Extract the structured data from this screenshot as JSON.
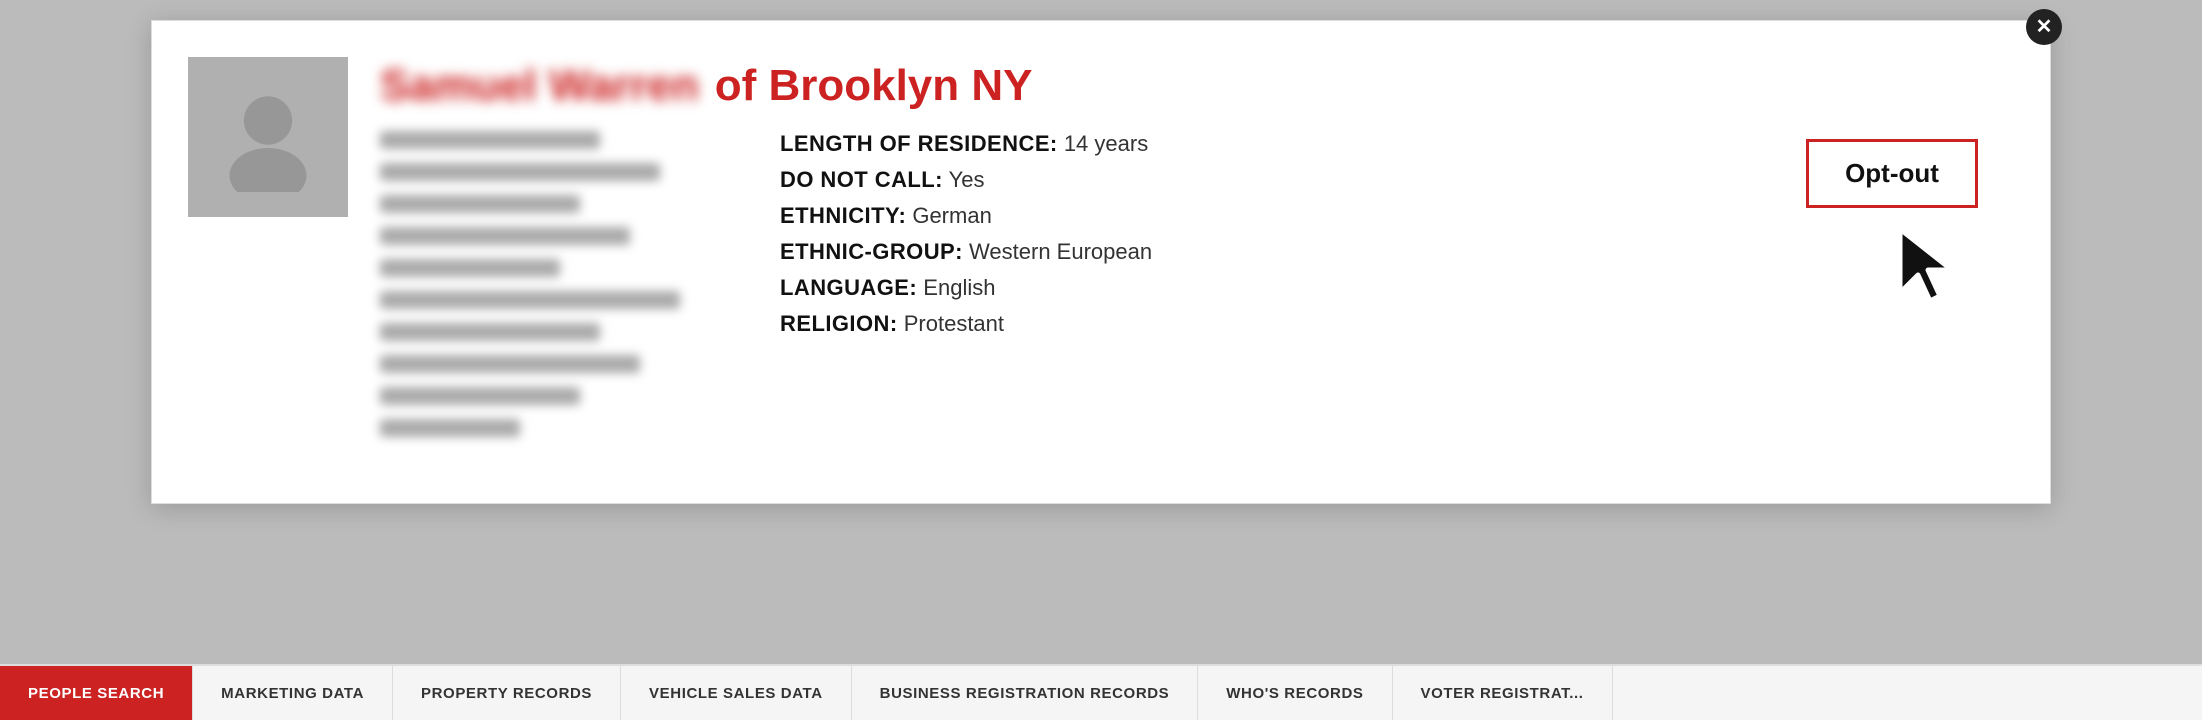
{
  "modal": {
    "close_label": "✕",
    "name_blurred": "Samuel Warren",
    "location": "of Brooklyn NY",
    "opt_out_label": "Opt-out",
    "details_right": [
      {
        "label": "LENGTH OF RESIDENCE:",
        "value": "14 years"
      },
      {
        "label": "DO NOT CALL:",
        "value": "Yes"
      },
      {
        "label": "ETHNICITY:",
        "value": "German"
      },
      {
        "label": "ETHNIC-GROUP:",
        "value": "Western European"
      },
      {
        "label": "LANGUAGE:",
        "value": "English"
      },
      {
        "label": "RELIGION:",
        "value": "Protestant"
      }
    ]
  },
  "bottom_tabs": [
    {
      "label": "PEOPLE SEARCH",
      "active": true
    },
    {
      "label": "MARKETING DATA",
      "active": false
    },
    {
      "label": "PROPERTY RECORDS",
      "active": false
    },
    {
      "label": "VEHICLE SALES DATA",
      "active": false
    },
    {
      "label": "BUSINESS REGISTRATION RECORDS",
      "active": false
    },
    {
      "label": "WHO'S RECORDS",
      "active": false
    },
    {
      "label": "VOTER REGISTRAT...",
      "active": false
    }
  ]
}
